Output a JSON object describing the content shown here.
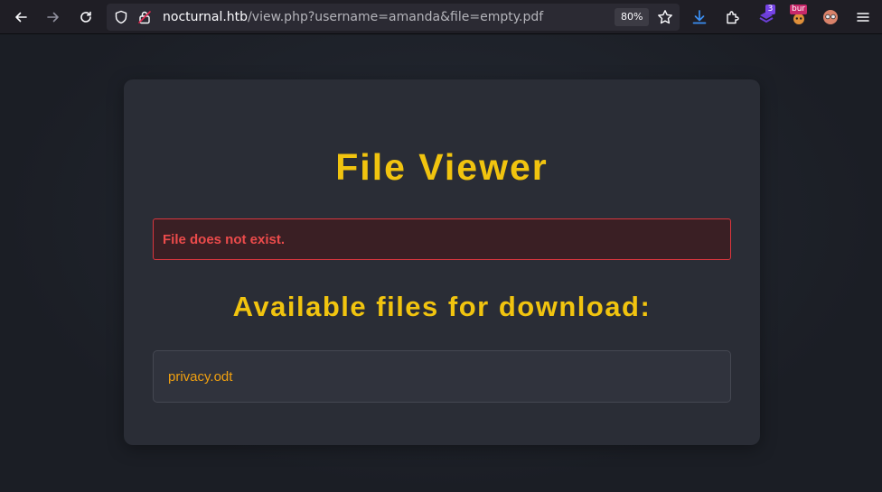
{
  "browser": {
    "url_host": "nocturnal.htb",
    "url_rest": "/view.php?username=amanda&file=empty.pdf",
    "zoom": "80%",
    "extension_badge_count": "3",
    "burp_label": "bur"
  },
  "page": {
    "title": "File Viewer",
    "error_message": "File does not exist.",
    "files_heading": "Available files for download:",
    "files": [
      "privacy.odt"
    ]
  },
  "colors": {
    "accent": "#f1c40f",
    "error": "#ec4b4b",
    "link": "#f0a010"
  }
}
